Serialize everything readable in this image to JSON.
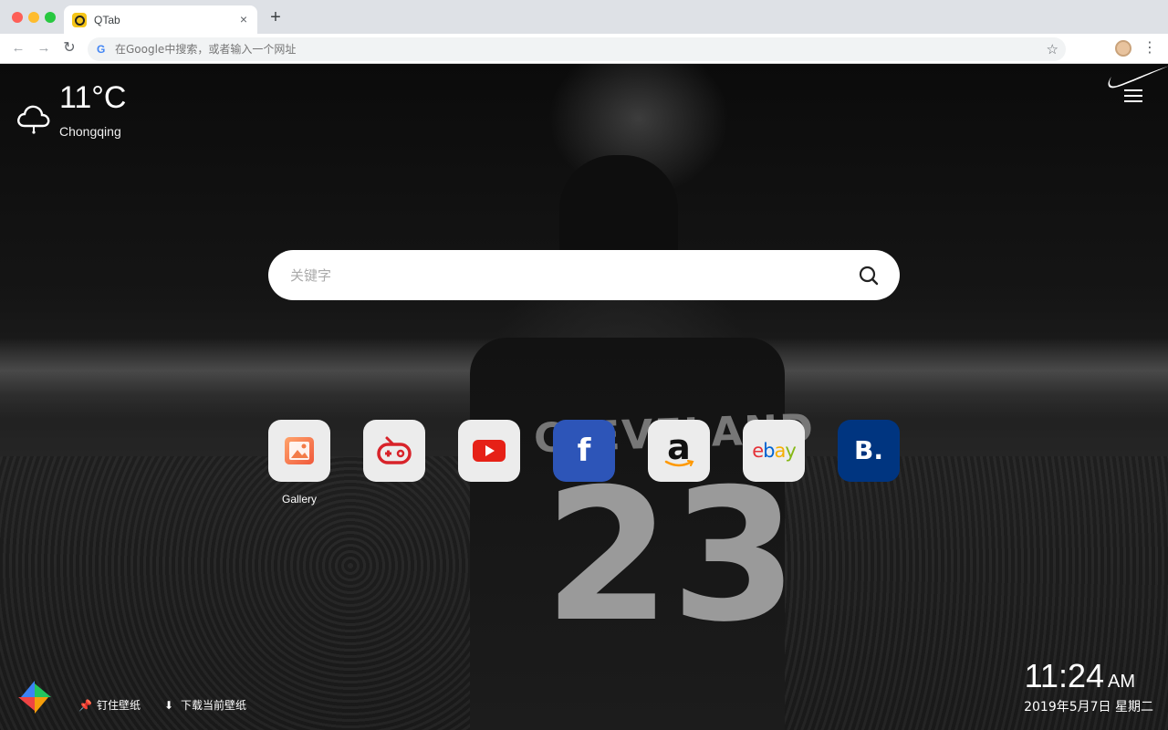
{
  "browser": {
    "tab_title": "QTab",
    "tab_close": "×",
    "new_tab": "+",
    "address_placeholder": "在Google中搜索，或者输入一个网址"
  },
  "weather": {
    "temperature": "11°C",
    "city": "Chongqing",
    "icon": "cloud-icon"
  },
  "search": {
    "placeholder": "关键字"
  },
  "shortcuts": [
    {
      "label": "Gallery",
      "icon": "gallery-icon",
      "bg": "#ffffff"
    },
    {
      "label": "",
      "icon": "gamepad-icon",
      "bg": "#ececec"
    },
    {
      "label": "",
      "icon": "youtube-icon",
      "bg": "#ececec"
    },
    {
      "label": "",
      "icon": "facebook-icon",
      "bg": "#2d55b8"
    },
    {
      "label": "",
      "icon": "amazon-icon",
      "bg": "#ececec"
    },
    {
      "label": "",
      "icon": "ebay-icon",
      "bg": "#ececec"
    },
    {
      "label": "",
      "icon": "booking-icon",
      "bg": "#003580"
    }
  ],
  "shortcut_glyphs": {
    "facebook": "f",
    "amazon": "a",
    "booking": "B."
  },
  "ebay_letters": [
    "e",
    "b",
    "a",
    "y"
  ],
  "wallpaper": {
    "jersey_text": "CLEVELAND",
    "jersey_number": "23"
  },
  "bottom": {
    "pin_label": "钉住壁纸",
    "download_label": "下载当前壁纸"
  },
  "clock": {
    "time": "11:24",
    "ampm": "AM",
    "date": "2019年5月7日 星期二"
  }
}
